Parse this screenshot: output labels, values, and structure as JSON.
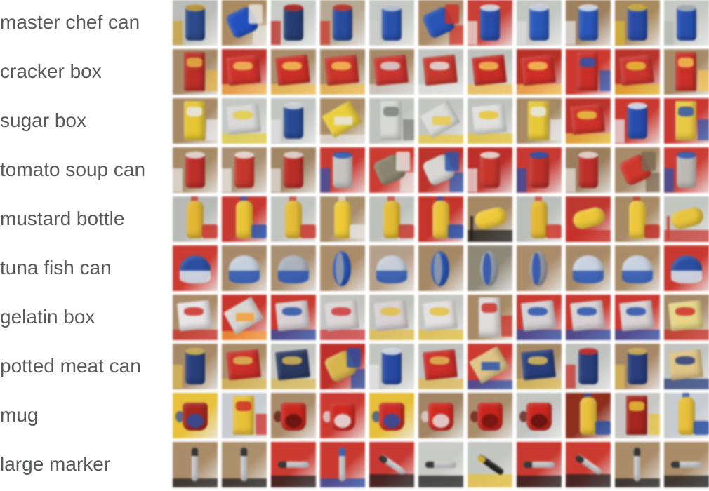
{
  "rows": [
    {
      "label": "master chef can",
      "tiles": [
        {
          "bg": "#b9bcb8",
          "obj": "#2c4a86",
          "acc": "#c9a23a",
          "shape": "can"
        },
        {
          "bg": "#a88a63",
          "obj": "#2450b8",
          "acc": "#e8e4df",
          "shape": "can-tilt"
        },
        {
          "bg": "#c8cbc7",
          "obj": "#263d6e",
          "acc": "#b52b25",
          "shape": "can"
        },
        {
          "bg": "#b6a894",
          "obj": "#2a4c9a",
          "acc": "#c23a2a",
          "shape": "can"
        },
        {
          "bg": "#c5c8c4",
          "obj": "#2b52a8",
          "acc": "#cfcfcf",
          "shape": "can"
        },
        {
          "bg": "#a98b6a",
          "obj": "#2a54b0",
          "acc": "#c7332a",
          "shape": "can-tilt"
        },
        {
          "bg": "#c3413a",
          "obj": "#2a4ea6",
          "acc": "#e9e5e1",
          "shape": "can"
        },
        {
          "bg": "#c4c6c2",
          "obj": "#2c58b4",
          "acc": "#dcdcdc",
          "shape": "can"
        },
        {
          "bg": "#9c8060",
          "obj": "#2d56b2",
          "acc": "#e5e5e8",
          "shape": "can"
        },
        {
          "bg": "#a78a61",
          "obj": "#2a4aa0",
          "acc": "#d8b63c",
          "shape": "can"
        },
        {
          "bg": "#c7c9c5",
          "obj": "#2a50aa",
          "acc": "#b5b8b3",
          "shape": "can"
        }
      ]
    },
    {
      "label": "cracker box",
      "tiles": [
        {
          "bg": "#a58a6a",
          "obj": "#b5302a",
          "acc": "#e0b04a",
          "shape": "box-tall"
        },
        {
          "bg": "#b8352e",
          "obj": "#c8342c",
          "acc": "#f0c060",
          "shape": "box"
        },
        {
          "bg": "#a88e6e",
          "obj": "#c43028",
          "acc": "#f2c25c",
          "shape": "box"
        },
        {
          "bg": "#a38868",
          "obj": "#c4362c",
          "acc": "#f2c25a",
          "shape": "box"
        },
        {
          "bg": "#a48a6a",
          "obj": "#c43430",
          "acc": "#d8d8d6",
          "shape": "box"
        },
        {
          "bg": "#c2c4c0",
          "obj": "#c03a30",
          "acc": "#e4e4e2",
          "shape": "box"
        },
        {
          "bg": "#bfc1bd",
          "obj": "#c02e28",
          "acc": "#f0c058",
          "shape": "box"
        },
        {
          "bg": "#b33229",
          "obj": "#c8302a",
          "acc": "#f3c45c",
          "shape": "box"
        },
        {
          "bg": "#c73a32",
          "obj": "#c3302a",
          "acc": "#2f55a8",
          "shape": "box-tall"
        },
        {
          "bg": "#b5352c",
          "obj": "#c43630",
          "acc": "#e6c03c",
          "shape": "box"
        },
        {
          "bg": "#a68b6a",
          "obj": "#c4312a",
          "acc": "#f1c15a",
          "shape": "box-tall"
        }
      ]
    },
    {
      "label": "sugar box",
      "tiles": [
        {
          "bg": "#a58968",
          "obj": "#e3c63a",
          "acc": "#e8e8ea",
          "shape": "box-tall"
        },
        {
          "bg": "#c5c8c4",
          "obj": "#d8d9d6",
          "acc": "#e2cd4a",
          "shape": "box"
        },
        {
          "bg": "#c2c5c1",
          "obj": "#2a4a90",
          "acc": "#e0e0e0",
          "shape": "can"
        },
        {
          "bg": "#a88c68",
          "obj": "#e8cd42",
          "acc": "#e6e6e6",
          "shape": "box-tilt"
        },
        {
          "bg": "#bfc2be",
          "obj": "#d8d9d6",
          "acc": "#7d7f7c",
          "shape": "box-tall"
        },
        {
          "bg": "#c3c5c1",
          "obj": "#dcdcda",
          "acc": "#e8c84a",
          "shape": "box-tilt"
        },
        {
          "bg": "#c0c2be",
          "obj": "#e0e0de",
          "acc": "#e6c43e",
          "shape": "box"
        },
        {
          "bg": "#a58a68",
          "obj": "#e4c840",
          "acc": "#e8e8ea",
          "shape": "box-tall"
        },
        {
          "bg": "#b5352d",
          "obj": "#c8342c",
          "acc": "#e8c64a",
          "shape": "box"
        },
        {
          "bg": "#c43a32",
          "obj": "#2a4ca8",
          "acc": "#e8e8ea",
          "shape": "can"
        },
        {
          "bg": "#c43832",
          "obj": "#e6c84a",
          "acc": "#2f55a8",
          "shape": "box-tall"
        }
      ]
    },
    {
      "label": "tomato soup can",
      "tiles": [
        {
          "bg": "#a68a68",
          "obj": "#b8302c",
          "acc": "#e8e6e4",
          "shape": "can"
        },
        {
          "bg": "#a89074",
          "obj": "#c0382e",
          "acc": "#ecebe8",
          "shape": "can"
        },
        {
          "bg": "#9f8566",
          "obj": "#b4302a",
          "acc": "#e4e2de",
          "shape": "can"
        },
        {
          "bg": "#c23b33",
          "obj": "#c8c4c0",
          "acc": "#2d55a8",
          "shape": "can"
        },
        {
          "bg": "#c63c34",
          "obj": "#8b8470",
          "acc": "#e6e2de",
          "shape": "can-tilt"
        },
        {
          "bg": "#b5352e",
          "obj": "#d8d6d2",
          "acc": "#2f55a8",
          "shape": "can-tilt"
        },
        {
          "bg": "#b8302c",
          "obj": "#c0362e",
          "acc": "#e9e4e0",
          "shape": "can"
        },
        {
          "bg": "#c23a34",
          "obj": "#b8322c",
          "acc": "#2a50aa",
          "shape": "can"
        },
        {
          "bg": "#9a7e60",
          "obj": "#b8302c",
          "acc": "#e6e2de",
          "shape": "can"
        },
        {
          "bg": "#a68c6e",
          "obj": "#c8382e",
          "acc": "#7a6a52",
          "shape": "can-tilt"
        },
        {
          "bg": "#c63e36",
          "obj": "#bdbab4",
          "acc": "#2c52a6",
          "shape": "can"
        }
      ]
    },
    {
      "label": "mustard bottle",
      "tiles": [
        {
          "bg": "#b8bab6",
          "obj": "#e0b63a",
          "acc": "#c2302a",
          "shape": "bottle"
        },
        {
          "bg": "#c23a32",
          "obj": "#e8c43c",
          "acc": "#2d55a8",
          "shape": "bottle"
        },
        {
          "bg": "#c2c4c0",
          "obj": "#e3bc3c",
          "acc": "#c4362e",
          "shape": "bottle"
        },
        {
          "bg": "#a88e6c",
          "obj": "#ecca3e",
          "acc": "#e6e2de",
          "shape": "bottle"
        },
        {
          "bg": "#bfc1bd",
          "obj": "#e2bc3a",
          "acc": "#c03a30",
          "shape": "bottle"
        },
        {
          "bg": "#c0362e",
          "obj": "#e6c23e",
          "acc": "#2c52a6",
          "shape": "bottle"
        },
        {
          "bg": "#a48866",
          "obj": "#ecca42",
          "acc": "#1e1e1e",
          "shape": "bottle-tilt"
        },
        {
          "bg": "#bcbfbb",
          "obj": "#e0b83a",
          "acc": "#c8382e",
          "shape": "bottle"
        },
        {
          "bg": "#b83a32",
          "obj": "#eac640",
          "acc": "#c4302a",
          "shape": "bottle-tilt"
        },
        {
          "bg": "#a68a68",
          "obj": "#ecc842",
          "acc": "#b82e28",
          "shape": "bottle"
        },
        {
          "bg": "#c4c6c2",
          "obj": "#e6c442",
          "acc": "#c23a32",
          "shape": "bottle-tilt"
        }
      ]
    },
    {
      "label": "tuna fish can",
      "tiles": [
        {
          "bg": "#c63c34",
          "obj": "#2c4e9c",
          "acc": "#e6e6e8",
          "shape": "tuna"
        },
        {
          "bg": "#a68a6c",
          "obj": "#c6d0dc",
          "acc": "#2b52a8",
          "shape": "tuna"
        },
        {
          "bg": "#a89074",
          "obj": "#aab2bc",
          "acc": "#2b52a8",
          "shape": "tuna"
        },
        {
          "bg": "#a88c6c",
          "obj": "#2c56b4",
          "acc": "#9aa0a8",
          "shape": "tuna-side"
        },
        {
          "bg": "#b5a08a",
          "obj": "#c6ced8",
          "acc": "#2c52a6",
          "shape": "tuna"
        },
        {
          "bg": "#a48868",
          "obj": "#2c56b4",
          "acc": "#9aa0a8",
          "shape": "tuna-side"
        },
        {
          "bg": "#8e8878",
          "obj": "#9aa0a6",
          "acc": "#2c52a8",
          "shape": "tuna-side"
        },
        {
          "bg": "#a88c6c",
          "obj": "#9a9aa0",
          "acc": "#2c52a8",
          "shape": "tuna-side"
        },
        {
          "bg": "#a68a6a",
          "obj": "#c8d2de",
          "acc": "#2b52a8",
          "shape": "tuna"
        },
        {
          "bg": "#a88c6a",
          "obj": "#c8d2de",
          "acc": "#2b52a8",
          "shape": "tuna"
        },
        {
          "bg": "#c43a32",
          "obj": "#2c4e9c",
          "acc": "#e6e6e8",
          "shape": "tuna"
        }
      ]
    },
    {
      "label": "gelatin box",
      "tiles": [
        {
          "bg": "#a88c6c",
          "obj": "#e8e4e6",
          "acc": "#c4302a",
          "shape": "box"
        },
        {
          "bg": "#c2362e",
          "obj": "#d8d6d2",
          "acc": "#f0a040",
          "shape": "box-tilt"
        },
        {
          "bg": "#c43a32",
          "obj": "#d8d0d2",
          "acc": "#2c52a6",
          "shape": "box"
        },
        {
          "bg": "#c2c4c0",
          "obj": "#dcd6d6",
          "acc": "#c8383a",
          "shape": "box"
        },
        {
          "bg": "#bfc1bd",
          "obj": "#d8d2d4",
          "acc": "#e0bc4a",
          "shape": "box"
        },
        {
          "bg": "#c4c6c2",
          "obj": "#e4e2e0",
          "acc": "#e2c044",
          "shape": "box"
        },
        {
          "bg": "#a68a68",
          "obj": "#e0dcdc",
          "acc": "#c4302a",
          "shape": "box-tall"
        },
        {
          "bg": "#c63c34",
          "obj": "#d6d2d4",
          "acc": "#2c52a6",
          "shape": "box"
        },
        {
          "bg": "#c43a32",
          "obj": "#d8d2d4",
          "acc": "#2c52a6",
          "shape": "box"
        },
        {
          "bg": "#c63a34",
          "obj": "#d8d2d4",
          "acc": "#2c52a6",
          "shape": "box"
        },
        {
          "bg": "#a48a6a",
          "obj": "#e6d68c",
          "acc": "#c4302a",
          "shape": "box"
        }
      ]
    },
    {
      "label": "potted meat can",
      "tiles": [
        {
          "bg": "#a58a6a",
          "obj": "#2a3e78",
          "acc": "#d8b85a",
          "shape": "can"
        },
        {
          "bg": "#a88c6a",
          "obj": "#c4302a",
          "acc": "#d8b85a",
          "shape": "box"
        },
        {
          "bg": "#c2c4c0",
          "obj": "#2c3a5e",
          "acc": "#d8b85a",
          "shape": "box"
        },
        {
          "bg": "#b8302a",
          "obj": "#d6b452",
          "acc": "#2c4e9c",
          "shape": "can-tilt"
        },
        {
          "bg": "#c2c4c0",
          "obj": "#2a4a9e",
          "acc": "#e4e4e6",
          "shape": "can"
        },
        {
          "bg": "#bfc1bd",
          "obj": "#c4302a",
          "acc": "#dcb85a",
          "shape": "box"
        },
        {
          "bg": "#c63c34",
          "obj": "#dcc48a",
          "acc": "#2c52a6",
          "shape": "box-tilt"
        },
        {
          "bg": "#a68a68",
          "obj": "#2a3e78",
          "acc": "#dcbe5e",
          "shape": "box"
        },
        {
          "bg": "#c0c2be",
          "obj": "#2a3e78",
          "acc": "#c4302a",
          "shape": "can"
        },
        {
          "bg": "#a68868",
          "obj": "#2a3e78",
          "acc": "#d8b85a",
          "shape": "can"
        },
        {
          "bg": "#c2c4c0",
          "obj": "#dcc48a",
          "acc": "#2a3e78",
          "shape": "box"
        }
      ]
    },
    {
      "label": "mug",
      "tiles": [
        {
          "bg": "#e6c040",
          "obj": "#a02820",
          "acc": "#2c4e9c",
          "shape": "mug"
        },
        {
          "bg": "#c8ccd0",
          "obj": "#e6c040",
          "acc": "#c42e28",
          "shape": "box-tall"
        },
        {
          "bg": "#a88c6c",
          "obj": "#c42820",
          "acc": "#5a1410",
          "shape": "mug"
        },
        {
          "bg": "#c63c34",
          "obj": "#c82a22",
          "acc": "#e6e6e8",
          "shape": "mug"
        },
        {
          "bg": "#e4be3e",
          "obj": "#c42c26",
          "acc": "#2c4e9c",
          "shape": "mug"
        },
        {
          "bg": "#a08466",
          "obj": "#c82a22",
          "acc": "#e4e0e0",
          "shape": "mug"
        },
        {
          "bg": "#a88e70",
          "obj": "#c42620",
          "acc": "#6a1612",
          "shape": "mug"
        },
        {
          "bg": "#c2c4c0",
          "obj": "#c42820",
          "acc": "#5a1410",
          "shape": "mug"
        },
        {
          "bg": "#8a3020",
          "obj": "#e6c040",
          "acc": "#2c4e9c",
          "shape": "bottle"
        },
        {
          "bg": "#c8c6c2",
          "obj": "#a02820",
          "acc": "#e4c040",
          "shape": "box-tall"
        },
        {
          "bg": "#c8ccd0",
          "obj": "#e6c040",
          "acc": "#2c4e9c",
          "shape": "bottle"
        }
      ]
    },
    {
      "label": "large marker",
      "tiles": [
        {
          "bg": "#a88c6c",
          "obj": "#d8d8da",
          "acc": "#1e1e1e",
          "shape": "marker"
        },
        {
          "bg": "#aa9070",
          "obj": "#d8d8da",
          "acc": "#1e1e1e",
          "shape": "marker"
        },
        {
          "bg": "#c63c34",
          "obj": "#d8d8da",
          "acc": "#1e1e1e",
          "shape": "marker-h"
        },
        {
          "bg": "#c43a32",
          "obj": "#d8d8da",
          "acc": "#2c52a6",
          "shape": "marker"
        },
        {
          "bg": "#c23a34",
          "obj": "#d8d8da",
          "acc": "#1e1e1e",
          "shape": "marker-tilt"
        },
        {
          "bg": "#c8cac6",
          "obj": "#d8d8da",
          "acc": "#1e1e1e",
          "shape": "marker-h"
        },
        {
          "bg": "#c4c6c2",
          "obj": "#1e1e1e",
          "acc": "#e6c040",
          "shape": "marker-tilt"
        },
        {
          "bg": "#c43a32",
          "obj": "#d8d8da",
          "acc": "#1e1e1e",
          "shape": "marker-h"
        },
        {
          "bg": "#c63c34",
          "obj": "#d8d8da",
          "acc": "#1e1e1e",
          "shape": "marker-tilt"
        },
        {
          "bg": "#a88c6c",
          "obj": "#d8d8da",
          "acc": "#1e1e1e",
          "shape": "marker"
        },
        {
          "bg": "#a88c6a",
          "obj": "#d8d8da",
          "acc": "#1e1e1e",
          "shape": "marker-h"
        }
      ]
    }
  ]
}
